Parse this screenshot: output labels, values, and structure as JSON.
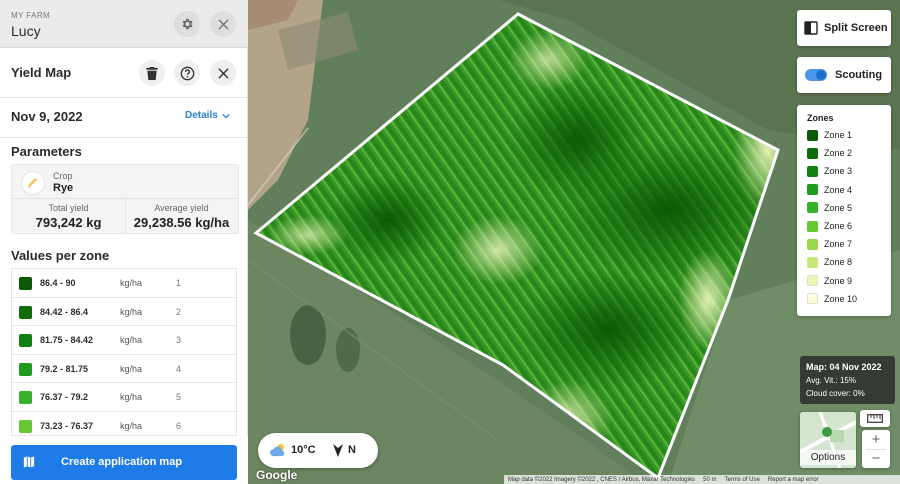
{
  "farm": {
    "label": "MY FARM",
    "name": "Lucy"
  },
  "panel": {
    "title": "Yield Map",
    "date": "Nov 9, 2022",
    "details_label": "Details",
    "parameters_title": "Parameters",
    "crop_label": "Crop",
    "crop_value": "Rye",
    "total_yield_label": "Total yield",
    "total_yield_value": "793,242 kg",
    "avg_yield_label": "Average yield",
    "avg_yield_value": "29,238.56 kg/ha",
    "values_title": "Values per zone",
    "cta_label": "Create application map"
  },
  "zones": [
    {
      "range": "86.4 - 90",
      "unit": "kg/ha",
      "num": "1",
      "color": "#0a5a05"
    },
    {
      "range": "84.42 - 86.4",
      "unit": "kg/ha",
      "num": "2",
      "color": "#0d6b08"
    },
    {
      "range": "81.75 - 84.42",
      "unit": "kg/ha",
      "num": "3",
      "color": "#138012"
    },
    {
      "range": "79.2 - 81.75",
      "unit": "kg/ha",
      "num": "4",
      "color": "#1e9a1e"
    },
    {
      "range": "76.37 - 79.2",
      "unit": "kg/ha",
      "num": "5",
      "color": "#36b22a"
    },
    {
      "range": "73.23 - 76.37",
      "unit": "kg/ha",
      "num": "6",
      "color": "#66c634"
    }
  ],
  "legend": {
    "title": "Zones",
    "items": [
      {
        "label": "Zone 1",
        "color": "#0a5a05"
      },
      {
        "label": "Zone 2",
        "color": "#0d6b08"
      },
      {
        "label": "Zone 3",
        "color": "#138012"
      },
      {
        "label": "Zone 4",
        "color": "#1e9a1e"
      },
      {
        "label": "Zone 5",
        "color": "#36b22a"
      },
      {
        "label": "Zone 6",
        "color": "#66c634"
      },
      {
        "label": "Zone 7",
        "color": "#9ad84a"
      },
      {
        "label": "Zone 8",
        "color": "#c6e97a"
      },
      {
        "label": "Zone 9",
        "color": "#eef5b0"
      },
      {
        "label": "Zone 10",
        "color": "#fbfce0"
      }
    ]
  },
  "map": {
    "split_screen_label": "Split Screen",
    "scouting_label": "Scouting",
    "scouting_on": true,
    "info_map_date": "Map: 04 Nov 2022",
    "info_avg_vit": "Avg. Vit.: 15%",
    "info_cloud": "Cloud cover: 0%",
    "temperature": "10°C",
    "wind": "N",
    "options_label": "Options",
    "google": "Google",
    "attribution": "Map data ©2022 Imagery ©2022 , CNES / Airbus, Maxar Technologies",
    "scale": "50 m",
    "terms": "Terms of Use",
    "report": "Report a map error"
  },
  "icons": {
    "settings": "gear-icon",
    "close": "close-icon",
    "collapse": "double-chevron-left-icon",
    "delete": "trash-icon",
    "help": "help-circle-icon",
    "crop": "wheat-icon"
  }
}
